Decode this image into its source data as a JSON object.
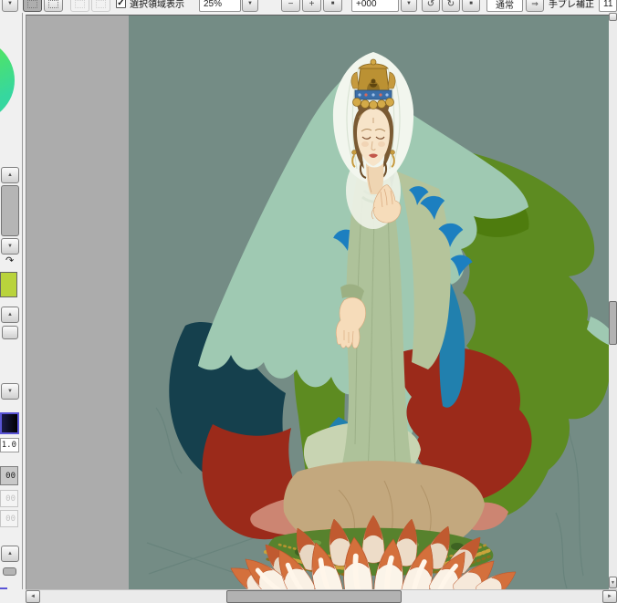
{
  "toolbar": {
    "selection_area_label": "選択領域表示",
    "zoom": {
      "value": "25%"
    },
    "rotation": {
      "value": "+000"
    },
    "blend_mode": {
      "value": "通常"
    },
    "stabilizer": {
      "label": "手ブレ補正",
      "value": "11"
    }
  },
  "left_panel": {
    "opacity_value": "1.0",
    "value_boxes": [
      "00",
      "00",
      "00"
    ],
    "primary_color": "#10102e",
    "secondary_color": "#b9d33c"
  },
  "icons": {
    "dropdown": "▼",
    "up": "▲",
    "down": "▼",
    "left": "◄",
    "right": "►",
    "minus": "−",
    "plus": "+",
    "reset": "■",
    "rotate_ccw": "↺",
    "rotate_cw": "↻",
    "apply_arrow": "⇒",
    "check": "✓",
    "swap": "↷"
  },
  "canvas": {
    "background_color": "#748c85",
    "out_of_canvas_color": "#acacac",
    "artwork_palette": {
      "veil_mint": "#9fc9b2",
      "cloak_olive": "#5d8b21",
      "fold_teal": "#15404d",
      "fold_blue": "#2180ae",
      "robe_maroon": "#9b2a1a",
      "robe_celadon": "#aec29a",
      "drape_tan": "#c3a87e",
      "cloth_salmon": "#cc8572",
      "skin": "#f6dcba",
      "hair_brown": "#7a5a33",
      "crown_gold": "#c69a3e",
      "lotus_petal_orange": "#d4703c",
      "lotus_pod_green": "#57822d"
    }
  }
}
